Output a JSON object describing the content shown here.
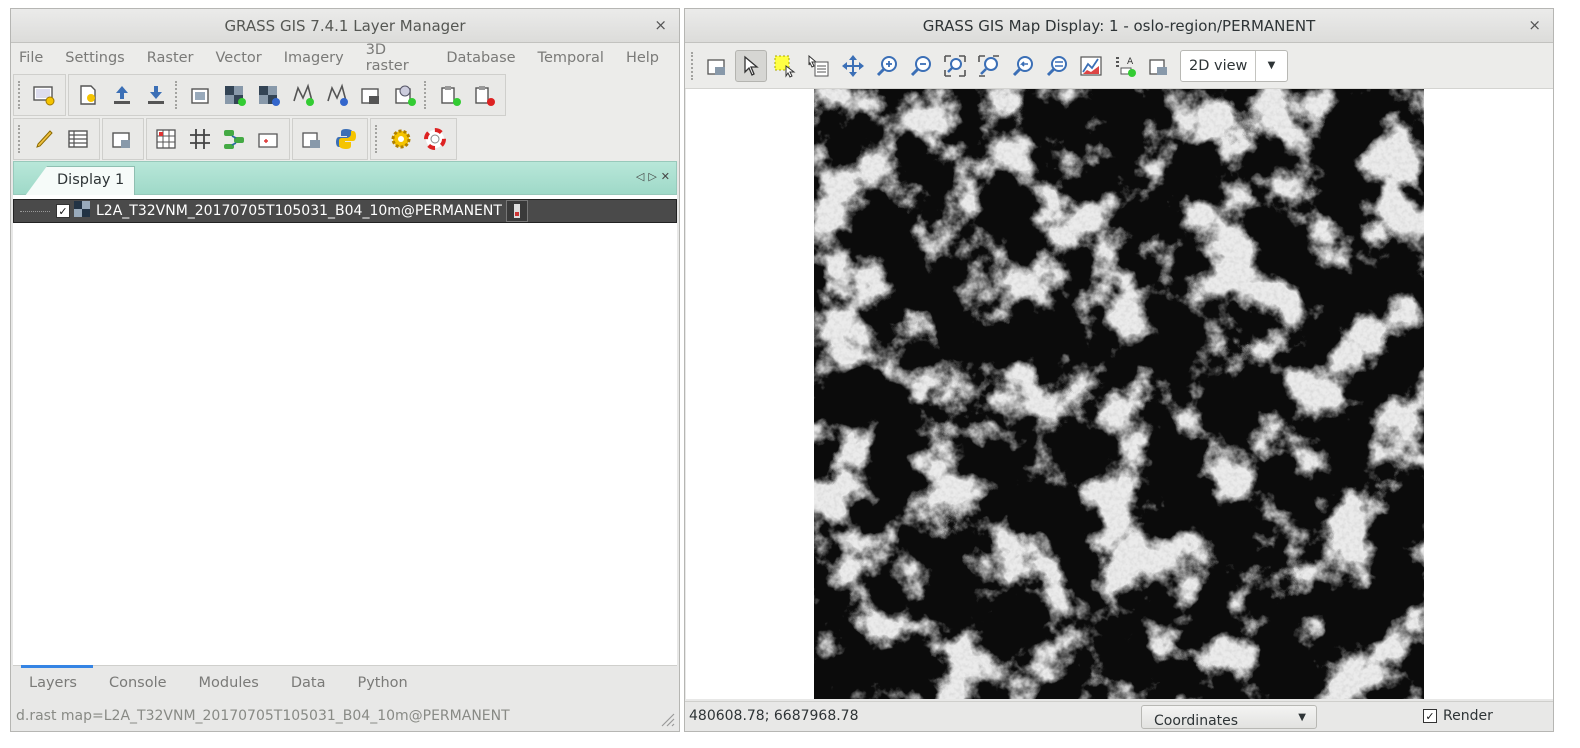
{
  "layer_manager": {
    "title": "GRASS GIS 7.4.1 Layer Manager",
    "close": "×",
    "menu": [
      "File",
      "Settings",
      "Raster",
      "Vector",
      "Imagery",
      "3D raster",
      "Database",
      "Temporal",
      "Help"
    ],
    "display_tab": "Display 1",
    "layer": {
      "name": "L2A_T32VNM_20170705T105031_B04_10m@PERMANENT",
      "checked": "✓"
    },
    "bottom_tabs": [
      "Layers",
      "Console",
      "Modules",
      "Data",
      "Python"
    ],
    "status": "d.rast map=L2A_T32VNM_20170705T105031_B04_10m@PERMANENT"
  },
  "map_display": {
    "title": "GRASS GIS Map Display: 1 - oslo-region/PERMANENT",
    "close": "×",
    "view_mode": "2D view",
    "coordinates": "480608.78; 6687968.78",
    "status_select": "Coordinates",
    "render_label": "Render",
    "render_checked": "✓"
  },
  "icons": {
    "layer_manager_row1": [
      "new-map-display-icon",
      "new-workspace-icon",
      "open-workspace-icon",
      "save-workspace-icon",
      "add-raster-icon",
      "add-rgb-icon",
      "add-multiple-raster-icon",
      "add-vector-icon",
      "add-multiple-vector-icon",
      "add-overlay-icon",
      "add-command-icon",
      "add-group-icon",
      "remove-layer-icon"
    ],
    "layer_manager_row2": [
      "edit-vector-icon",
      "attribute-table-icon",
      "layer-properties-icon",
      "georectifier-icon",
      "grid-icon",
      "graphical-modeler-icon",
      "cartographic-composer-icon",
      "map-swipe-icon",
      "python-shell-icon",
      "settings-icon",
      "help-icon"
    ],
    "map_display": [
      "render-map-icon",
      "pointer-icon",
      "select-icon",
      "query-icon",
      "pan-icon",
      "zoom-in-icon",
      "zoom-out-icon",
      "zoom-extent-icon",
      "zoom-region-icon",
      "zoom-back-icon",
      "zoom-options-icon",
      "analyze-icon",
      "decorations-icon",
      "save-display-icon"
    ]
  },
  "colors": {
    "notebook_bg": "#a8dfd0",
    "selected_layer_bg": "#4a4a4a",
    "active_tab_accent": "#3584e4"
  }
}
